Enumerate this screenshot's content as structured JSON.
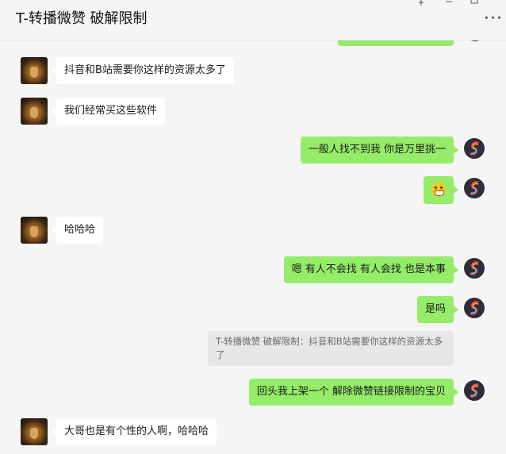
{
  "window": {
    "title": "T-转播微赞 破解限制",
    "controls": [
      "pin",
      "minimize",
      "maximize"
    ],
    "more_label": "···"
  },
  "messages": [
    {
      "side": "left",
      "text": "抖音和B站需要你这样的资源太多了"
    },
    {
      "side": "left",
      "text": "我们经常买这些软件"
    },
    {
      "side": "right",
      "text": "一般人找不到我 你是万里挑一"
    },
    {
      "side": "right",
      "emoji": "grinning-face"
    },
    {
      "side": "left",
      "text": "哈哈哈"
    },
    {
      "side": "right",
      "text": "嗯 有人不会找 有人会找 也是本事"
    },
    {
      "side": "right",
      "text": "是吗"
    },
    {
      "side": "quote",
      "text": "T-转播微赞 破解限制：抖音和B站需要你这样的资源太多了"
    },
    {
      "side": "right",
      "text": "回头我上架一个 解除微赞链接限制的宝贝"
    },
    {
      "side": "left",
      "text": "大哥也是有个性的人啊，哈哈哈"
    }
  ],
  "colors": {
    "background": "#f5f5f5",
    "self_bubble": "#95ec69",
    "other_bubble": "#ffffff",
    "quote_bg": "#e7e7e7"
  }
}
